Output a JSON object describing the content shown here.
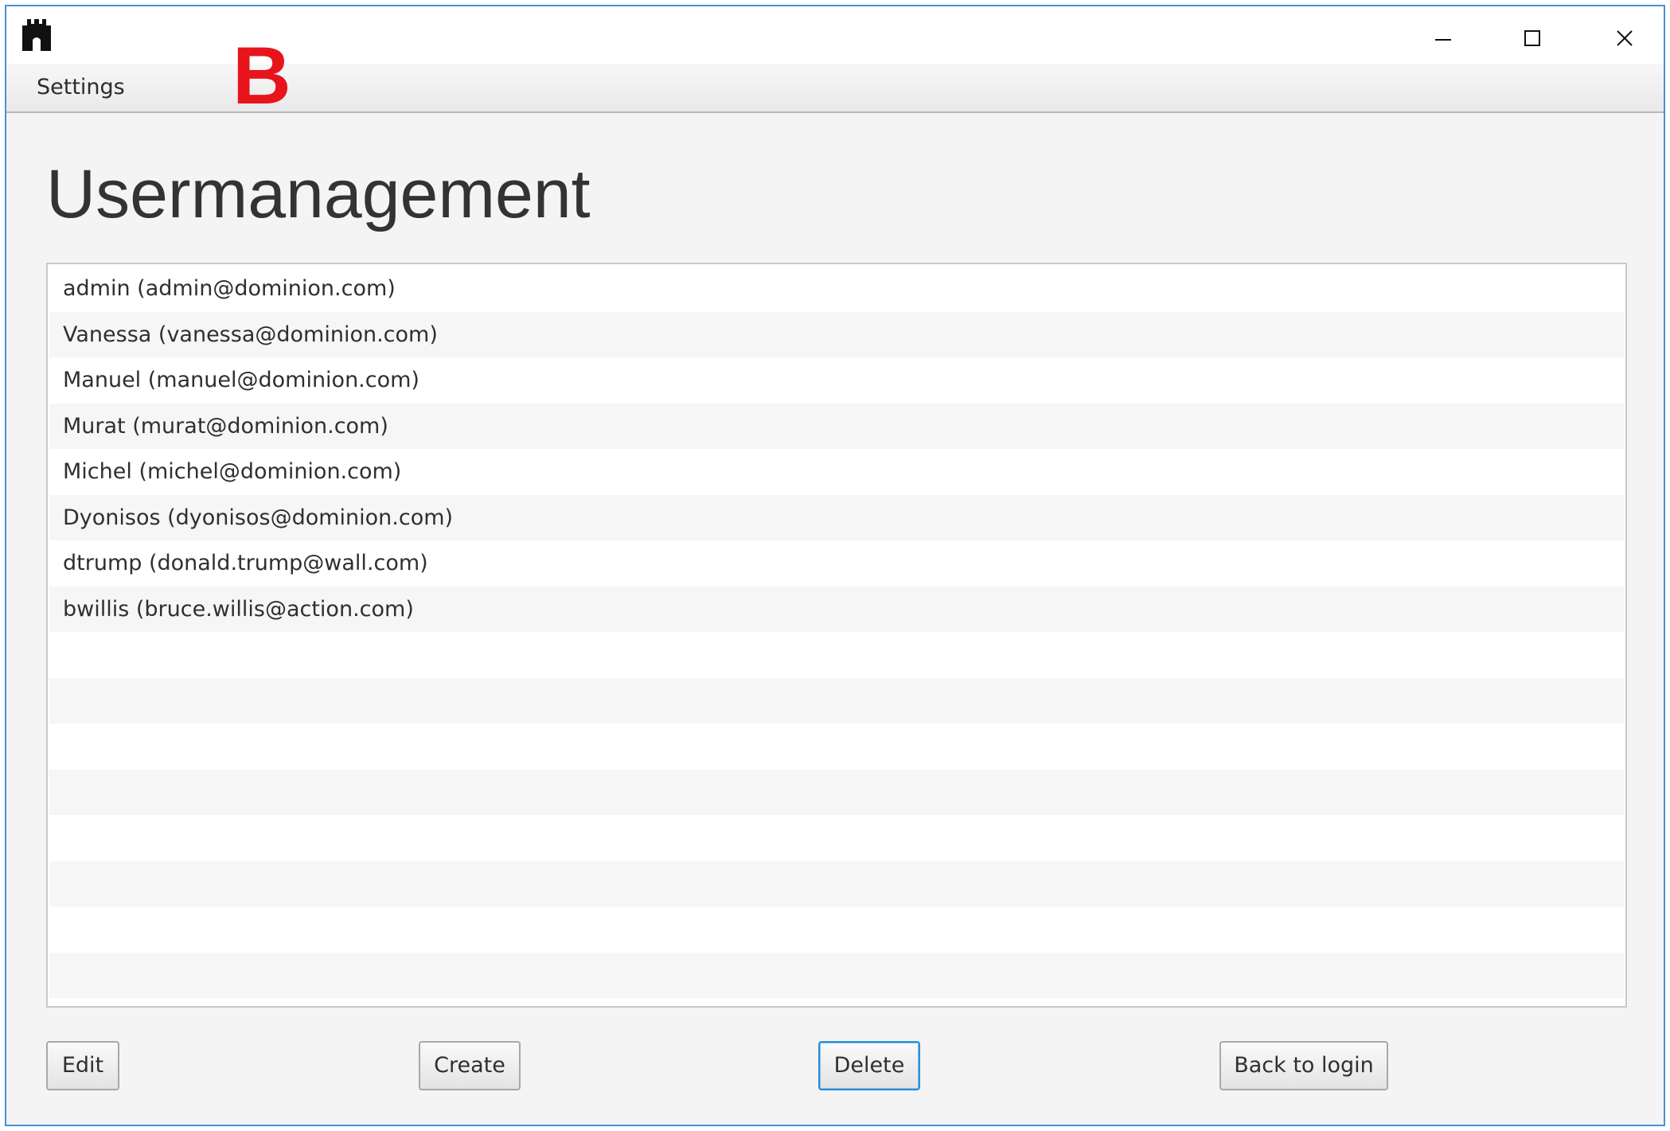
{
  "window": {
    "controls": [
      "minimize",
      "maximize",
      "close"
    ]
  },
  "menubar": {
    "settings_label": "Settings",
    "brand_mark": "B",
    "brand_color": "#e8141c"
  },
  "main": {
    "title": "Usermanagement",
    "users": [
      "admin (admin@dominion.com)",
      "Vanessa (vanessa@dominion.com)",
      "Manuel (manuel@dominion.com)",
      "Murat (murat@dominion.com)",
      "Michel (michel@dominion.com)",
      "Dyonisos (dyonisos@dominion.com)",
      "dtrump (donald.trump@wall.com)",
      "bwillis (bruce.willis@action.com)",
      "",
      "",
      "",
      "",
      "",
      "",
      "",
      ""
    ]
  },
  "actions": {
    "edit_label": "Edit",
    "create_label": "Create",
    "delete_label": "Delete",
    "back_label": "Back to login"
  },
  "colors": {
    "window_border": "#4a90d9",
    "focus_border": "#2a8fd6"
  }
}
